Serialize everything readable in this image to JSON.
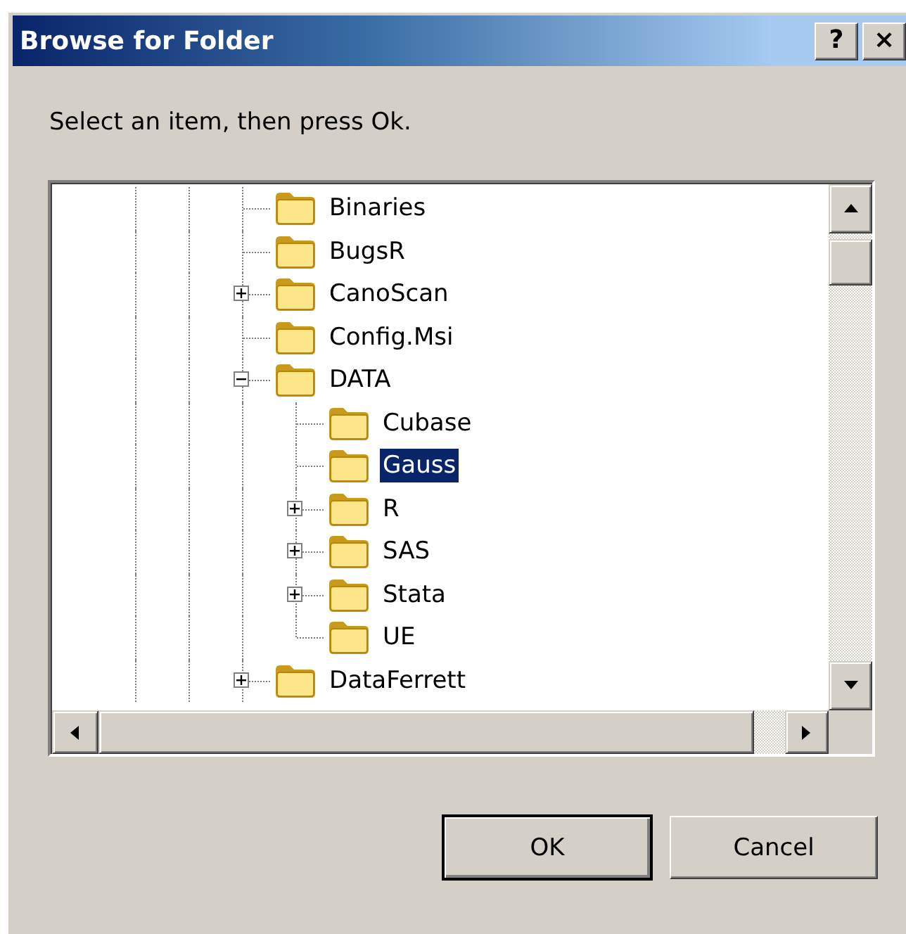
{
  "window": {
    "title": "Browse for Folder",
    "title_buttons": [
      "?",
      "×"
    ]
  },
  "prompt": "Select an item, then press Ok.",
  "tree": {
    "items": [
      {
        "label": "Binaries",
        "expandable": false,
        "selected": false
      },
      {
        "label": "BugsR",
        "expandable": false,
        "selected": false
      },
      {
        "label": "CanoScan",
        "expandable": true,
        "expanded": false,
        "selected": false
      },
      {
        "label": "Config.Msi",
        "expandable": false,
        "selected": false
      },
      {
        "label": "DATA",
        "expandable": true,
        "expanded": true,
        "selected": false,
        "children": [
          {
            "label": "Cubase",
            "expandable": false,
            "selected": false
          },
          {
            "label": "Gauss",
            "expandable": false,
            "selected": true
          },
          {
            "label": "R",
            "expandable": true,
            "expanded": false,
            "selected": false
          },
          {
            "label": "SAS",
            "expandable": true,
            "expanded": false,
            "selected": false
          },
          {
            "label": "Stata",
            "expandable": true,
            "expanded": false,
            "selected": false
          },
          {
            "label": "UE",
            "expandable": false,
            "selected": false
          }
        ]
      },
      {
        "label": "DataFerrett",
        "expandable": true,
        "expanded": false,
        "selected": false
      }
    ]
  },
  "buttons": [
    {
      "label": "OK",
      "default": true
    },
    {
      "label": "Cancel",
      "default": false
    }
  ]
}
